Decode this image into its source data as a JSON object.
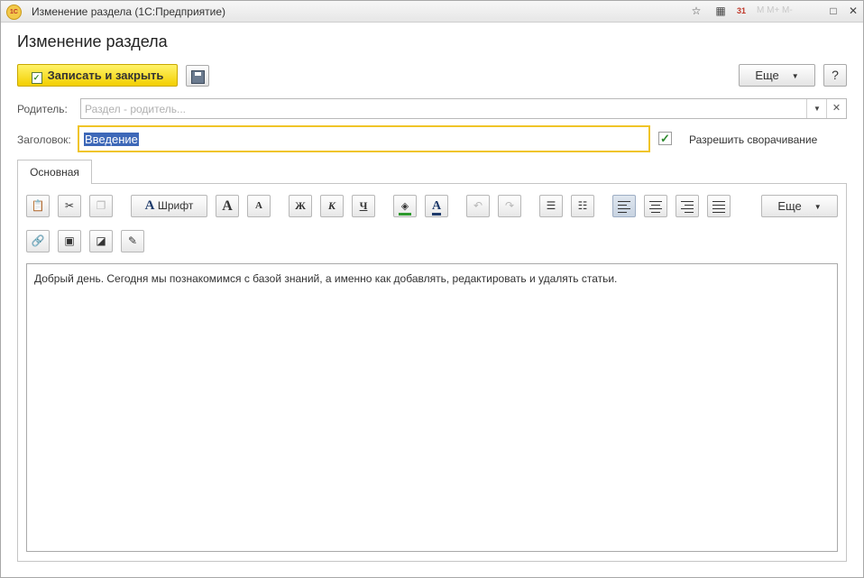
{
  "window": {
    "title": "Изменение раздела  (1С:Предприятие)",
    "app_icon_text": "1C",
    "controls": [
      "bookmark-icon",
      "calculator-icon",
      "calendar-icon",
      "memory-buttons",
      "restore-icon",
      "close-icon"
    ],
    "calendar_number": "31",
    "memory_labels": "M  M+  M-",
    "restore_label": "□",
    "close_label": "✕"
  },
  "page": {
    "title": "Изменение раздела"
  },
  "toolbar": {
    "save_close_label": "Записать и закрыть",
    "more_label": "Еще",
    "help_label": "?"
  },
  "form": {
    "parent_label": "Родитель:",
    "parent_placeholder": "Раздел - родитель...",
    "heading_label": "Заголовок:",
    "heading_value": "Введение",
    "allow_collapse_label": "Разрешить сворачивание",
    "allow_collapse_checked": true
  },
  "tabs": [
    {
      "label": "Основная",
      "active": true
    }
  ],
  "editor_toolbar": {
    "font_label": "Шрифт",
    "bold_label": "Ж",
    "italic_label": "К",
    "underline_label": "Ч",
    "more_label": "Еще"
  },
  "editor": {
    "text": "Добрый день. Сегодня мы познакомимся с базой знаний, а именно как добавлять, редактировать и удалять статьи."
  },
  "colors": {
    "primary_button": "#f3cf00",
    "focus_border": "#f0c428",
    "selection": "#3d68b8",
    "check": "#2e8a2e"
  }
}
